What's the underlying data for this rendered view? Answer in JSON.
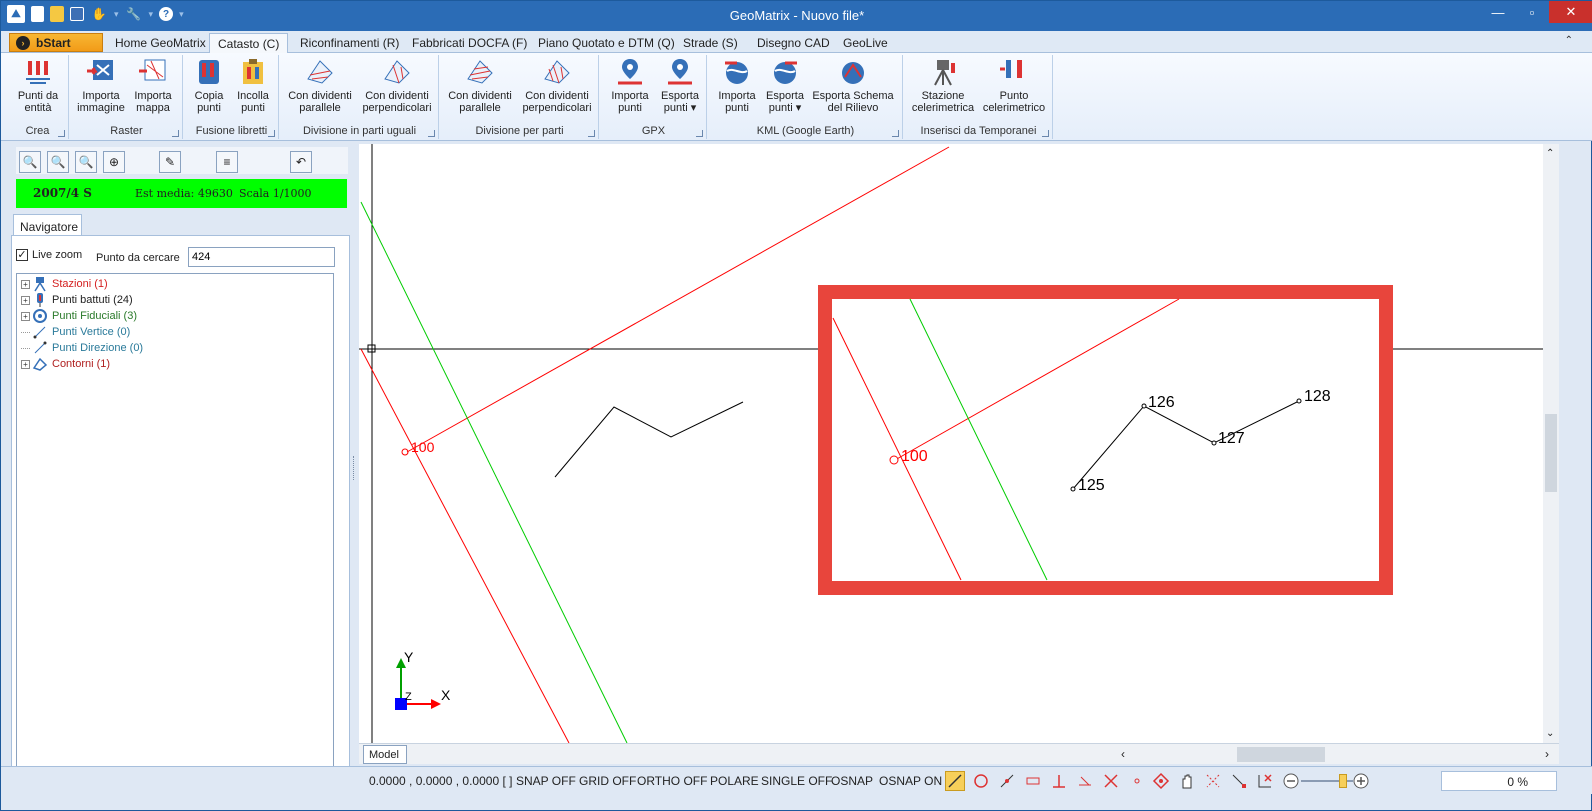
{
  "window": {
    "title": "GeoMatrix - Nuovo file*"
  },
  "colors": {
    "accent": "#2b6cb6",
    "green_bar": "#00ff00",
    "highlight_box": "#e8453c",
    "red_line": "#ff0000",
    "green_line": "#00cc00"
  },
  "quick_access": [
    "app-logo-icon",
    "new-file-icon",
    "open-folder-icon",
    "save-icon",
    "hand-tool-icon",
    "wrench-icon",
    "help-icon"
  ],
  "tabs": {
    "start": "bStart",
    "items": [
      "Home GeoMatrix",
      "Catasto (C)",
      "Riconfinamenti (R)",
      "Fabbricati DOCFA (F)",
      "Piano Quotato e DTM (Q)",
      "Strade (S)",
      "Disegno CAD",
      "GeoLive"
    ],
    "active": "Catasto (C)"
  },
  "ribbon": {
    "groups": [
      {
        "label": "Crea",
        "buttons": [
          [
            "Punti da",
            "entità"
          ]
        ]
      },
      {
        "label": "Raster",
        "buttons": [
          [
            "Importa",
            "immagine"
          ],
          [
            "Importa",
            "mappa"
          ]
        ]
      },
      {
        "label": "Fusione libretti",
        "buttons": [
          [
            "Copia",
            "punti"
          ],
          [
            "Incolla",
            "punti"
          ]
        ]
      },
      {
        "label": "Divisione in parti uguali",
        "buttons": [
          [
            "Con dividenti",
            "parallele"
          ],
          [
            "Con dividenti",
            "perpendicolari"
          ]
        ]
      },
      {
        "label": "Divisione per parti",
        "buttons": [
          [
            "Con dividenti",
            "parallele"
          ],
          [
            "Con dividenti",
            "perpendicolari"
          ]
        ]
      },
      {
        "label": "GPX",
        "buttons": [
          [
            "Importa",
            "punti"
          ],
          [
            "Esporta",
            "punti ▾"
          ]
        ]
      },
      {
        "label": "KML (Google Earth)",
        "buttons": [
          [
            "Importa",
            "punti"
          ],
          [
            "Esporta",
            "punti ▾"
          ],
          [
            "Esporta Schema",
            "del Rilievo"
          ]
        ]
      },
      {
        "label": "Inserisci da Temporanei",
        "buttons": [
          [
            "Stazione",
            "celerimetrica"
          ],
          [
            "Punto",
            "celerimetrico"
          ]
        ]
      }
    ]
  },
  "left_panel": {
    "info_bar": {
      "code": "2007/4 S",
      "est": "Est media: 49630",
      "scale": "Scala 1/1000"
    },
    "nav_tab": "Navigatore",
    "live_zoom_label": "Live zoom",
    "live_zoom_checked": true,
    "search_label": "Punto da cercare",
    "search_value": "424",
    "tree": [
      {
        "label": "Stazioni (1)",
        "color": "#d42020",
        "expandable": true,
        "icon": "station-icon"
      },
      {
        "label": "Punti battuti (24)",
        "color": "#222222",
        "expandable": true,
        "icon": "point-marker-icon"
      },
      {
        "label": "Punti Fiduciali (3)",
        "color": "#2a7a2a",
        "expandable": true,
        "icon": "fiducial-icon"
      },
      {
        "label": "Punti Vertice (0)",
        "color": "#2a7a9a",
        "expandable": false,
        "icon": "vertex-icon"
      },
      {
        "label": "Punti Direzione (0)",
        "color": "#2a7a9a",
        "expandable": false,
        "icon": "direction-icon"
      },
      {
        "label": "Contorni (1)",
        "color": "#b02020",
        "expandable": true,
        "icon": "contour-icon"
      }
    ]
  },
  "canvas": {
    "labels": {
      "main_point": "100",
      "zoom_point": "100",
      "p125": "125",
      "p126": "126",
      "p127": "127",
      "p128": "128",
      "axis_y": "Y",
      "axis_x": "X",
      "axis_z": "Z"
    },
    "model_tab": "Model"
  },
  "status": {
    "coords": "0.0000 , 0.0000 , 0.0000 [ ]",
    "toggles": [
      "SNAP OFF",
      "GRID OFF",
      "ORTHO OFF",
      "POLARE",
      "SINGLE OFF",
      "OSNAP",
      "OSNAP ON"
    ],
    "zoom_percent": "0 %"
  }
}
